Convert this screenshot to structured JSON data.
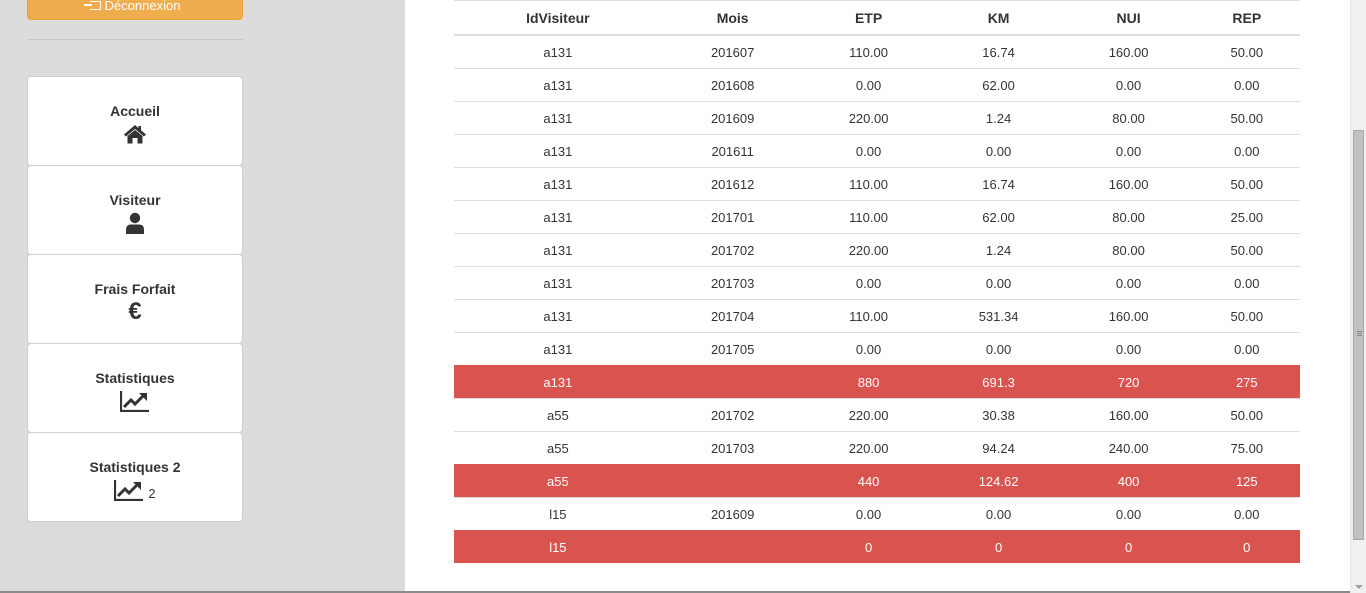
{
  "sidebar": {
    "logout_label": "Déconnexion",
    "menu": [
      {
        "label": "Accueil",
        "icon": "home-icon"
      },
      {
        "label": "Visiteur",
        "icon": "user-icon"
      },
      {
        "label": "Frais Forfait",
        "icon": "euro-icon",
        "glyph": "€"
      },
      {
        "label": "Statistiques",
        "icon": "chart-line-icon"
      },
      {
        "label": "Statistiques 2",
        "icon": "chart-line-icon",
        "suffix": "2"
      }
    ]
  },
  "table": {
    "headers": [
      "IdVisiteur",
      "Mois",
      "ETP",
      "KM",
      "NUI",
      "REP"
    ],
    "rows": [
      {
        "id": "a131",
        "mois": "201607",
        "etp": "110.00",
        "km": "16.74",
        "nui": "160.00",
        "rep": "50.00",
        "total": false
      },
      {
        "id": "a131",
        "mois": "201608",
        "etp": "0.00",
        "km": "62.00",
        "nui": "0.00",
        "rep": "0.00",
        "total": false
      },
      {
        "id": "a131",
        "mois": "201609",
        "etp": "220.00",
        "km": "1.24",
        "nui": "80.00",
        "rep": "50.00",
        "total": false
      },
      {
        "id": "a131",
        "mois": "201611",
        "etp": "0.00",
        "km": "0.00",
        "nui": "0.00",
        "rep": "0.00",
        "total": false
      },
      {
        "id": "a131",
        "mois": "201612",
        "etp": "110.00",
        "km": "16.74",
        "nui": "160.00",
        "rep": "50.00",
        "total": false
      },
      {
        "id": "a131",
        "mois": "201701",
        "etp": "110.00",
        "km": "62.00",
        "nui": "80.00",
        "rep": "25.00",
        "total": false
      },
      {
        "id": "a131",
        "mois": "201702",
        "etp": "220.00",
        "km": "1.24",
        "nui": "80.00",
        "rep": "50.00",
        "total": false
      },
      {
        "id": "a131",
        "mois": "201703",
        "etp": "0.00",
        "km": "0.00",
        "nui": "0.00",
        "rep": "0.00",
        "total": false
      },
      {
        "id": "a131",
        "mois": "201704",
        "etp": "110.00",
        "km": "531.34",
        "nui": "160.00",
        "rep": "50.00",
        "total": false
      },
      {
        "id": "a131",
        "mois": "201705",
        "etp": "0.00",
        "km": "0.00",
        "nui": "0.00",
        "rep": "0.00",
        "total": false
      },
      {
        "id": "a131",
        "mois": "",
        "etp": "880",
        "km": "691.3",
        "nui": "720",
        "rep": "275",
        "total": true
      },
      {
        "id": "a55",
        "mois": "201702",
        "etp": "220.00",
        "km": "30.38",
        "nui": "160.00",
        "rep": "50.00",
        "total": false
      },
      {
        "id": "a55",
        "mois": "201703",
        "etp": "220.00",
        "km": "94.24",
        "nui": "240.00",
        "rep": "75.00",
        "total": false
      },
      {
        "id": "a55",
        "mois": "",
        "etp": "440",
        "km": "124.62",
        "nui": "400",
        "rep": "125",
        "total": true
      },
      {
        "id": "l15",
        "mois": "201609",
        "etp": "0.00",
        "km": "0.00",
        "nui": "0.00",
        "rep": "0.00",
        "total": false
      },
      {
        "id": "l15",
        "mois": "",
        "etp": "0",
        "km": "0",
        "nui": "0",
        "rep": "0",
        "total": true
      }
    ]
  },
  "colors": {
    "logout_bg": "#f0ad4e",
    "total_row_bg": "#d9534f"
  }
}
